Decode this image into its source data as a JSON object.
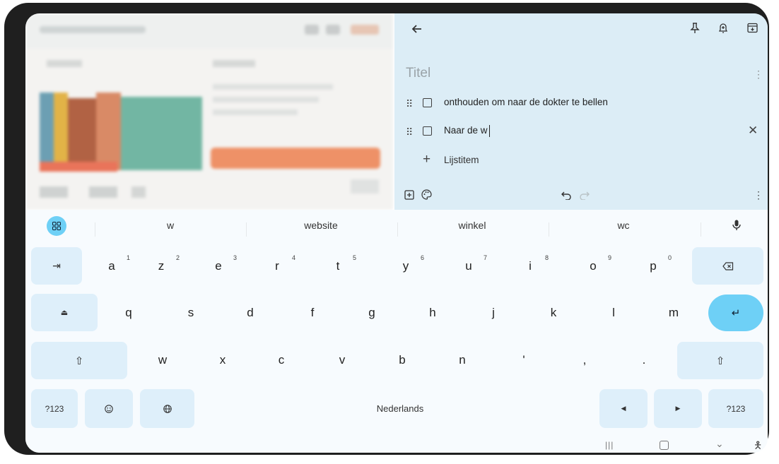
{
  "note": {
    "title_placeholder": "Titel",
    "items": [
      {
        "text": "onthouden om naar de dokter te bellen",
        "checked": false
      },
      {
        "text": "Naar de w",
        "checked": false
      }
    ],
    "add_item_label": "Lijstitem",
    "icons": {
      "back": "arrow-left-icon",
      "pin": "pin-icon",
      "reminder": "bell-plus-icon",
      "archive": "archive-icon",
      "more": "more-vert-icon",
      "clear": "close-icon",
      "add_box": "add-box-icon",
      "palette": "palette-icon",
      "undo": "undo-icon",
      "redo": "redo-icon"
    }
  },
  "keyboard": {
    "suggestions": [
      "w",
      "website",
      "winkel",
      "wc"
    ],
    "row1": [
      {
        "key": "a",
        "num": "1"
      },
      {
        "key": "z",
        "num": "2"
      },
      {
        "key": "e",
        "num": "3"
      },
      {
        "key": "r",
        "num": "4"
      },
      {
        "key": "t",
        "num": "5"
      },
      {
        "key": "y",
        "num": "6"
      },
      {
        "key": "u",
        "num": "7"
      },
      {
        "key": "i",
        "num": "8"
      },
      {
        "key": "o",
        "num": "9"
      },
      {
        "key": "p",
        "num": "0"
      }
    ],
    "row2": [
      "q",
      "s",
      "d",
      "f",
      "g",
      "h",
      "j",
      "k",
      "l",
      "m"
    ],
    "row3": [
      "w",
      "x",
      "c",
      "v",
      "b",
      "n",
      "'",
      ",",
      "."
    ],
    "symbols_label": "?123",
    "space_label": "Nederlands",
    "accent_color": "#6ed0f6",
    "key_color": "#deeffa"
  }
}
